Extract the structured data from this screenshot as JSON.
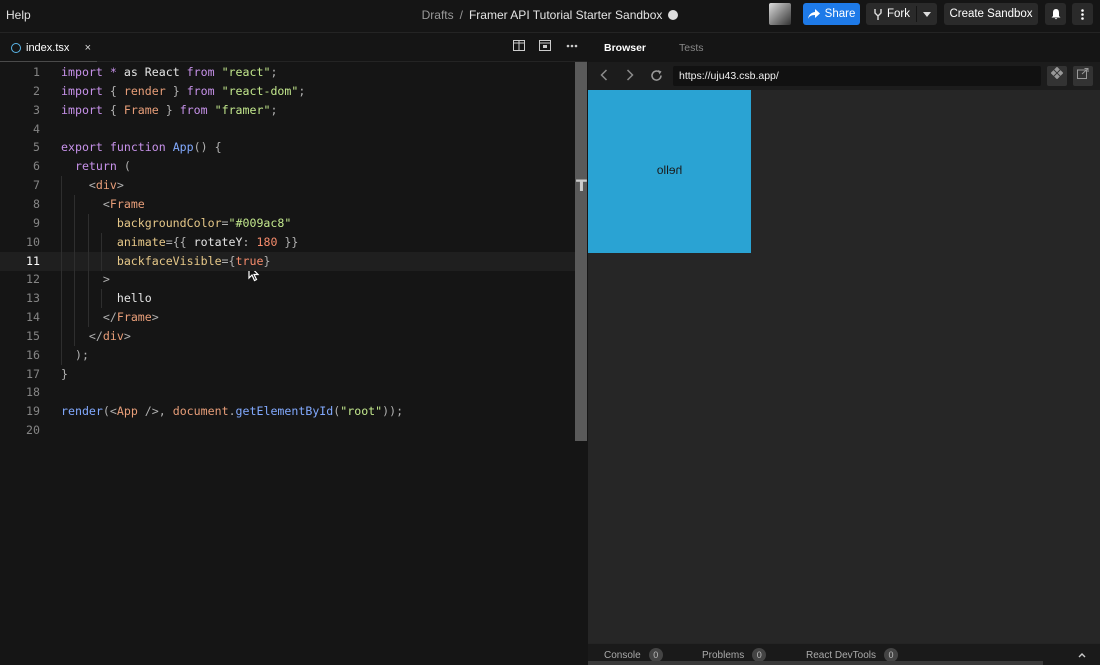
{
  "menu": {
    "help": "Help"
  },
  "header": {
    "crumb": "Drafts",
    "separator": "/",
    "title": "Framer API Tutorial Starter Sandbox",
    "share": "Share",
    "fork": "Fork",
    "create_sandbox": "Create Sandbox"
  },
  "editor": {
    "tab_name": "index.tsx",
    "close_glyph": "×",
    "active_line": 11,
    "lines": [
      {
        "n": "1"
      },
      {
        "n": "2"
      },
      {
        "n": "3"
      },
      {
        "n": "4"
      },
      {
        "n": "5"
      },
      {
        "n": "6"
      },
      {
        "n": "7"
      },
      {
        "n": "8"
      },
      {
        "n": "9"
      },
      {
        "n": "10"
      },
      {
        "n": "11"
      },
      {
        "n": "12"
      },
      {
        "n": "13"
      },
      {
        "n": "14"
      },
      {
        "n": "15"
      },
      {
        "n": "16"
      },
      {
        "n": "17"
      },
      {
        "n": "18"
      },
      {
        "n": "19"
      },
      {
        "n": "20"
      }
    ],
    "code": [
      [
        [
          "kw",
          "import"
        ],
        [
          "txt",
          " "
        ],
        [
          "kw",
          "*"
        ],
        [
          "txt",
          " as React "
        ],
        [
          "kw",
          "from"
        ],
        [
          "txt",
          " "
        ],
        [
          "str",
          "\"react\""
        ],
        [
          "punc",
          ";"
        ]
      ],
      [
        [
          "kw",
          "import"
        ],
        [
          "punc",
          " { "
        ],
        [
          "tag",
          "render"
        ],
        [
          "punc",
          " } "
        ],
        [
          "kw",
          "from"
        ],
        [
          "txt",
          " "
        ],
        [
          "str",
          "\"react-dom\""
        ],
        [
          "punc",
          ";"
        ]
      ],
      [
        [
          "kw",
          "import"
        ],
        [
          "punc",
          " { "
        ],
        [
          "tag",
          "Frame"
        ],
        [
          "punc",
          " } "
        ],
        [
          "kw",
          "from"
        ],
        [
          "txt",
          " "
        ],
        [
          "str",
          "\"framer\""
        ],
        [
          "punc",
          ";"
        ]
      ],
      [],
      [
        [
          "kw",
          "export"
        ],
        [
          "txt",
          " "
        ],
        [
          "kw",
          "function"
        ],
        [
          "txt",
          " "
        ],
        [
          "fn",
          "App"
        ],
        [
          "punc",
          "() {"
        ]
      ],
      [
        [
          "txt",
          "  "
        ],
        [
          "kw",
          "return"
        ],
        [
          "punc",
          " ("
        ]
      ],
      [
        [
          "txt",
          "    "
        ],
        [
          "punc",
          "<"
        ],
        [
          "tag",
          "div"
        ],
        [
          "punc",
          ">"
        ]
      ],
      [
        [
          "txt",
          "      "
        ],
        [
          "punc",
          "<"
        ],
        [
          "tag",
          "Frame"
        ]
      ],
      [
        [
          "txt",
          "        "
        ],
        [
          "attr",
          "backgroundColor"
        ],
        [
          "punc",
          "="
        ],
        [
          "str",
          "\"#009ac8\""
        ]
      ],
      [
        [
          "txt",
          "        "
        ],
        [
          "attr",
          "animate"
        ],
        [
          "punc",
          "={{ "
        ],
        [
          "txt",
          "rotateY"
        ],
        [
          "punc",
          ": "
        ],
        [
          "num",
          "180"
        ],
        [
          "punc",
          " }}"
        ]
      ],
      [
        [
          "txt",
          "        "
        ],
        [
          "attr",
          "backfaceVisible"
        ],
        [
          "punc",
          "={"
        ],
        [
          "num",
          "true"
        ],
        [
          "punc",
          "}"
        ]
      ],
      [
        [
          "txt",
          "      "
        ],
        [
          "punc",
          ">"
        ]
      ],
      [
        [
          "txt",
          "        hello"
        ]
      ],
      [
        [
          "txt",
          "      "
        ],
        [
          "punc",
          "</"
        ],
        [
          "tag",
          "Frame"
        ],
        [
          "punc",
          ">"
        ]
      ],
      [
        [
          "txt",
          "    "
        ],
        [
          "punc",
          "</"
        ],
        [
          "tag",
          "div"
        ],
        [
          "punc",
          ">"
        ]
      ],
      [
        [
          "txt",
          "  "
        ],
        [
          "punc",
          ");"
        ]
      ],
      [
        [
          "punc",
          "}"
        ]
      ],
      [],
      [
        [
          "fn",
          "render"
        ],
        [
          "punc",
          "(<"
        ],
        [
          "tag",
          "App"
        ],
        [
          "punc",
          " />, "
        ],
        [
          "tag",
          "document"
        ],
        [
          "punc",
          "."
        ],
        [
          "fn",
          "getElementById"
        ],
        [
          "punc",
          "("
        ],
        [
          "str",
          "\"root\""
        ],
        [
          "punc",
          "));"
        ]
      ],
      []
    ]
  },
  "preview": {
    "tab_browser": "Browser",
    "tab_tests": "Tests",
    "url": "https://uju43.csb.app/",
    "frame_text": "hello",
    "frame_color": "#2aa3d3"
  },
  "bottom": {
    "console": "Console",
    "console_count": "0",
    "problems": "Problems",
    "problems_count": "0",
    "devtools": "React DevTools",
    "devtools_count": "0"
  }
}
